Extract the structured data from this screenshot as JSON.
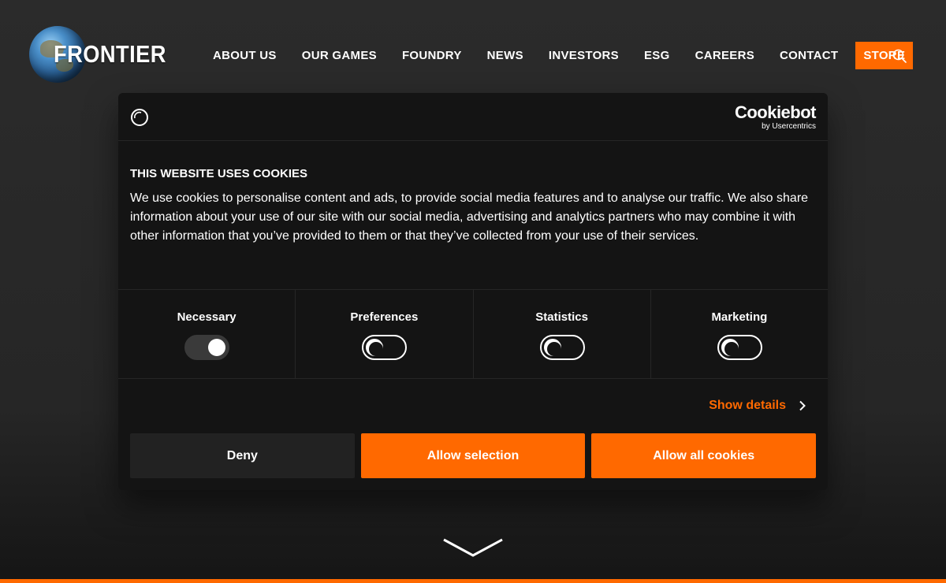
{
  "header": {
    "logo_text": "FRONTIER",
    "nav": [
      {
        "label": "ABOUT US"
      },
      {
        "label": "OUR GAMES"
      },
      {
        "label": "FOUNDRY"
      },
      {
        "label": "NEWS"
      },
      {
        "label": "INVESTORS"
      },
      {
        "label": "ESG"
      },
      {
        "label": "CAREERS"
      },
      {
        "label": "CONTACT"
      }
    ],
    "store_label": "STORE",
    "search_icon": "search-icon"
  },
  "cookie_dialog": {
    "brand_name": "Cookiebot",
    "brand_sub": "by Usercentrics",
    "title": "THIS WEBSITE USES COOKIES",
    "text": "We use cookies to personalise content and ads, to provide social media features and to analyse our traffic. We also share information about your use of our site with our social media, advertising and analytics partners who may combine it with other information that you’ve provided to them or that they’ve collected from your use of their services.",
    "toggles": [
      {
        "label": "Necessary",
        "checked": true,
        "disabled": true
      },
      {
        "label": "Preferences",
        "checked": false,
        "disabled": false
      },
      {
        "label": "Statistics",
        "checked": false,
        "disabled": false
      },
      {
        "label": "Marketing",
        "checked": false,
        "disabled": false
      }
    ],
    "show_details_label": "Show details",
    "buttons": {
      "deny": "Deny",
      "allow_selection": "Allow selection",
      "allow_all": "Allow all cookies"
    }
  },
  "colors": {
    "accent": "#ff6900",
    "dialog_bg": "#141414",
    "page_bg": "#2a2a2a"
  }
}
